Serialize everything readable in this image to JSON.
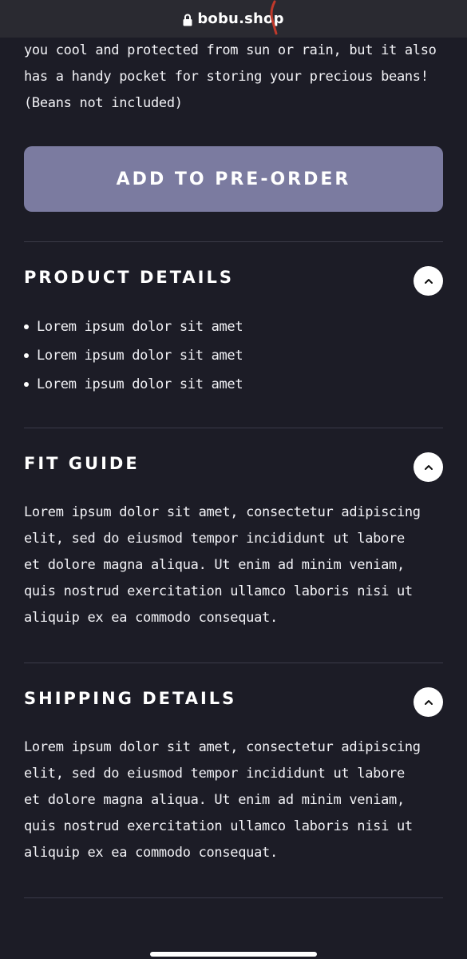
{
  "browser": {
    "url": "bobu.shop"
  },
  "product": {
    "description_tail": "you cool and protected from sun or rain, but it also has a handy pocket for storing your precious beans! (Beans not included)",
    "preorder_label": "ADD TO PRE-ORDER"
  },
  "sections": {
    "product_details": {
      "title": "PRODUCT DETAILS",
      "items": [
        "Lorem ipsum dolor sit amet",
        "Lorem ipsum dolor sit amet",
        "Lorem ipsum dolor sit amet"
      ]
    },
    "fit_guide": {
      "title": "FIT GUIDE",
      "body": "Lorem ipsum dolor sit amet, consectetur adipiscing elit, sed do eiusmod tempor incididunt ut labore et dolore magna aliqua. Ut enim ad minim veniam, quis nostrud exercitation ullamco laboris nisi ut aliquip ex ea commodo consequat."
    },
    "shipping_details": {
      "title": "SHIPPING DETAILS",
      "body": "Lorem ipsum dolor sit amet, consectetur adipiscing elit, sed do eiusmod tempor incididunt ut labore et dolore magna aliqua. Ut enim ad minim veniam, quis nostrud exercitation ullamco laboris nisi ut aliquip ex ea commodo consequat."
    }
  },
  "icons": {
    "lock": "lock-icon",
    "toggle": "chevron-up-icon"
  },
  "colors": {
    "background": "#1c1c26",
    "button": "#7b7ba0",
    "divider": "#3a3a48"
  }
}
